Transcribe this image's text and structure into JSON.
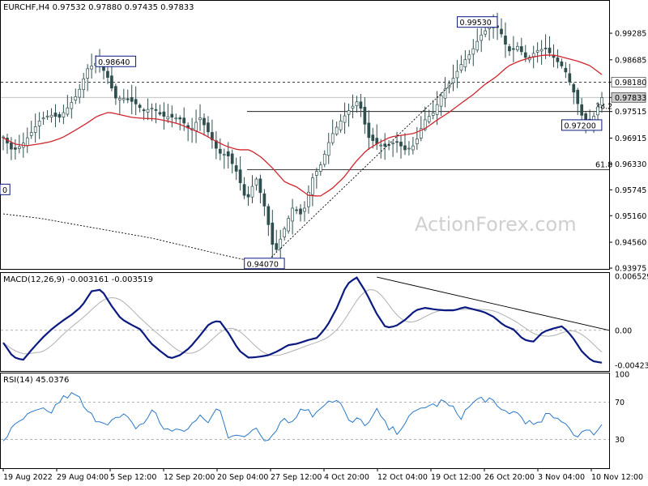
{
  "header": {
    "symbol_line": "EURCHF,H4  0.97532 0.97880 0.97435 0.97833",
    "macd_line": "MACD(12,26,9) -0.003161 -0.003519",
    "rsi_line": "RSI(14) 45.0376",
    "watermark": "ActionForex.com"
  },
  "colors": {
    "candle": "#2f4f4f",
    "moving_average": "#d0262e",
    "macd": "#0b1a80",
    "signal": "#b0b0b0",
    "rsi": "#2a78c8",
    "trendline": "#000000",
    "label_border": "#0b1a80",
    "grid": "#a0a0a0"
  },
  "chart_data": [
    {
      "type": "candlestick",
      "symbol": "EURCHF",
      "timeframe": "H4",
      "ohlc_last": {
        "open": 0.97532,
        "high": 0.9788,
        "low": 0.97435,
        "close": 0.97833
      },
      "ylim": [
        0.93975,
        1.0
      ],
      "yticks": [
        "0.99285",
        "0.98685",
        "0.98180",
        "0.97833",
        "0.97515",
        "0.96915",
        "0.96330",
        "0.95745",
        "0.95160",
        "0.94560",
        "0.93975"
      ],
      "xticks": [
        "19 Aug 2022",
        "29 Aug 04:00",
        "5 Sep 12:00",
        "12 Sep 20:00",
        "20 Sep 04:00",
        "27 Sep 12:00",
        "4 Oct 20:00",
        "12 Oct 04:00",
        "19 Oct 12:00",
        "26 Oct 20:00",
        "3 Nov 04:00",
        "10 Nov 12:00"
      ],
      "bar_count": 150,
      "ma_close": [
        0.9694,
        0.9662,
        0.9676,
        0.9704,
        0.9734,
        0.9744,
        0.9738,
        0.9763,
        0.9793,
        0.9848,
        0.9862,
        0.9838,
        0.9782,
        0.9781,
        0.9772,
        0.9753,
        0.976,
        0.9741,
        0.9739,
        0.9734,
        0.9708,
        0.9739,
        0.9702,
        0.9658,
        0.9653,
        0.9613,
        0.9547,
        0.9603,
        0.9532,
        0.9428,
        0.9483,
        0.9537,
        0.9515,
        0.9599,
        0.9633,
        0.9694,
        0.9728,
        0.9755,
        0.9778,
        0.9694,
        0.9678,
        0.9672,
        0.9684,
        0.9664,
        0.9676,
        0.9731,
        0.9749,
        0.9796,
        0.9823,
        0.9859,
        0.9884,
        0.9922,
        0.9944,
        0.9941,
        0.9887,
        0.9899,
        0.9869,
        0.9889,
        0.9894,
        0.987,
        0.9848,
        0.9795,
        0.9734,
        0.9734,
        0.9783
      ],
      "ma_values": [
        0.9692,
        0.9678,
        0.9674,
        0.9678,
        0.9683,
        0.9692,
        0.9707,
        0.9723,
        0.9741,
        0.975,
        0.9744,
        0.9738,
        0.9736,
        0.9735,
        0.973,
        0.9723,
        0.9712,
        0.9701,
        0.9686,
        0.9673,
        0.9665,
        0.9665,
        0.9648,
        0.9622,
        0.9592,
        0.9581,
        0.9562,
        0.956,
        0.9577,
        0.9602,
        0.9637,
        0.9665,
        0.9681,
        0.9694,
        0.9698,
        0.9702,
        0.9714,
        0.9733,
        0.975,
        0.977,
        0.9789,
        0.9812,
        0.983,
        0.9854,
        0.9866,
        0.9874,
        0.9879,
        0.9879,
        0.9872,
        0.9865,
        0.9855,
        0.9835
      ],
      "series": [
        {
          "name": "SMA (red)",
          "values": []
        },
        {
          "name": "Close",
          "values": []
        }
      ],
      "horizontal_lines": [
        {
          "value": 0.9818,
          "style": "dashed",
          "label": "0.98180"
        },
        {
          "value": 0.97833,
          "style": "solid-light",
          "label": "0.97833"
        },
        {
          "value": 0.97515,
          "style": "solid",
          "label": "38.2"
        },
        {
          "value": 0.962,
          "style": "solid",
          "label": "61.8"
        }
      ],
      "annotations": [
        {
          "text": "0.98640",
          "bar": 28,
          "value": 0.9864
        },
        {
          "text": "0.94070",
          "bar": 65,
          "value": 0.9407
        },
        {
          "text": "0.99530",
          "bar": 118,
          "value": 0.9953
        },
        {
          "text": "0.97200",
          "bar": 144,
          "value": 0.972
        },
        {
          "text": "0",
          "bar": 0,
          "value": 0.95745
        }
      ]
    },
    {
      "type": "line",
      "name": "MACD(12,26,9)",
      "macd": -0.003161,
      "signal": -0.003519,
      "ylim": [
        -0.0047,
        0.0068
      ],
      "yticks": [
        "0.006529",
        "0.00",
        "-0.004233"
      ],
      "macd_values": [
        -0.0015,
        -0.0032,
        -0.0036,
        -0.0022,
        -0.0009,
        0.0002,
        0.0011,
        0.0019,
        0.0029,
        0.0047,
        0.0049,
        0.003,
        0.0014,
        0.0007,
        0.0001,
        -0.0015,
        -0.0025,
        -0.0034,
        -0.003,
        -0.0021,
        -0.0007,
        0.0008,
        0.0012,
        -0.0004,
        -0.0024,
        -0.0033,
        -0.0032,
        -0.003,
        -0.0025,
        -0.0018,
        -0.0016,
        -0.0012,
        -0.0009,
        0.0005,
        0.0027,
        0.0055,
        0.0064,
        0.0045,
        0.0021,
        0.0003,
        0.0005,
        0.0013,
        0.0024,
        0.0027,
        0.0025,
        0.0024,
        0.0024,
        0.0028,
        0.0025,
        0.0022,
        0.0016,
        0.0006,
        0.0001,
        -0.0011,
        -0.0014,
        -0.0002,
        0.0002,
        0.0005,
        -0.0008,
        -0.0026,
        -0.0037,
        -0.0039
      ]
    },
    {
      "type": "line",
      "name": "RSI(14)",
      "value": 45.0376,
      "ylim": [
        0,
        100
      ],
      "levels": [
        70,
        30
      ],
      "yticks": [
        "100",
        "70",
        "30",
        "0"
      ],
      "rsi_values": [
        30,
        41,
        51,
        57,
        61,
        58,
        71,
        78,
        76,
        58,
        52,
        49,
        51,
        55,
        43,
        47,
        63,
        42,
        41,
        38,
        45,
        53,
        49,
        66,
        34,
        38,
        30,
        44,
        28,
        40,
        54,
        48,
        67,
        55,
        67,
        73,
        70,
        47,
        51,
        46,
        61,
        43,
        38,
        49,
        58,
        66,
        66,
        71,
        63,
        55,
        67,
        74,
        73,
        61,
        60,
        58,
        49,
        43,
        56,
        52,
        51,
        35,
        38,
        37,
        45
      ]
    }
  ]
}
